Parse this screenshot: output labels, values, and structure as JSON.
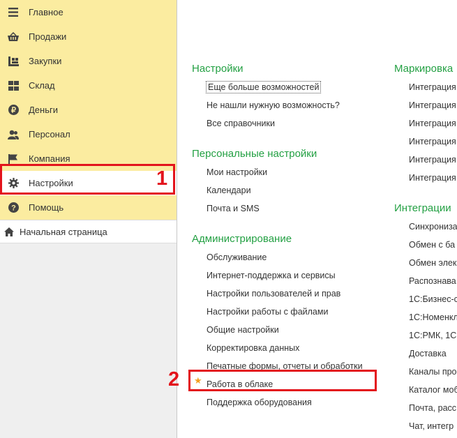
{
  "sidebar": {
    "items": [
      {
        "label": "Главное",
        "icon": "menu-lines-icon"
      },
      {
        "label": "Продажи",
        "icon": "basket-icon"
      },
      {
        "label": "Закупки",
        "icon": "purchases-icon"
      },
      {
        "label": "Склад",
        "icon": "warehouse-grid-icon"
      },
      {
        "label": "Деньги",
        "icon": "ruble-coin-icon"
      },
      {
        "label": "Персонал",
        "icon": "people-icon"
      },
      {
        "label": "Компания",
        "icon": "flag-icon"
      },
      {
        "label": "Настройки",
        "icon": "gear-icon"
      },
      {
        "label": "Помощь",
        "icon": "question-icon"
      }
    ],
    "home_label": "Начальная страница"
  },
  "sections_left": [
    {
      "title": "Настройки",
      "links": [
        "Еще больше возможностей",
        "Не нашли нужную возможность?",
        "Все справочники"
      ]
    },
    {
      "title": "Персональные настройки",
      "links": [
        "Мои настройки",
        "Календари",
        "Почта и SMS"
      ]
    },
    {
      "title": "Администрирование",
      "links": [
        "Обслуживание",
        "Интернет-поддержка и сервисы",
        "Настройки пользователей и прав",
        "Настройки работы с файлами",
        "Общие настройки",
        "Корректировка данных",
        "Печатные формы, отчеты и обработки",
        "Работа в облаке",
        "Поддержка оборудования"
      ]
    }
  ],
  "sections_right": [
    {
      "title": "Маркировка",
      "links": [
        "Интеграция",
        "Интеграция",
        "Интеграция",
        "Интеграция",
        "Интеграция",
        "Интеграция"
      ]
    },
    {
      "title": "Интеграции",
      "links": [
        "Синхрониза",
        "Обмен с ба",
        "Обмен элек",
        "Распознава",
        "1С:Бизнес-с",
        "1С:Номенкл",
        "1С:РМК, 1С",
        "Доставка",
        "Каналы про",
        "Каталог моб",
        "Почта, расс",
        "Чат, интегр"
      ]
    }
  ],
  "annotations": {
    "marker1": "1",
    "marker2": "2"
  },
  "colors": {
    "sidebar_bg": "#fbeca0",
    "section_title": "#23a043",
    "highlight": "#e3141c",
    "star": "#f4a020"
  }
}
